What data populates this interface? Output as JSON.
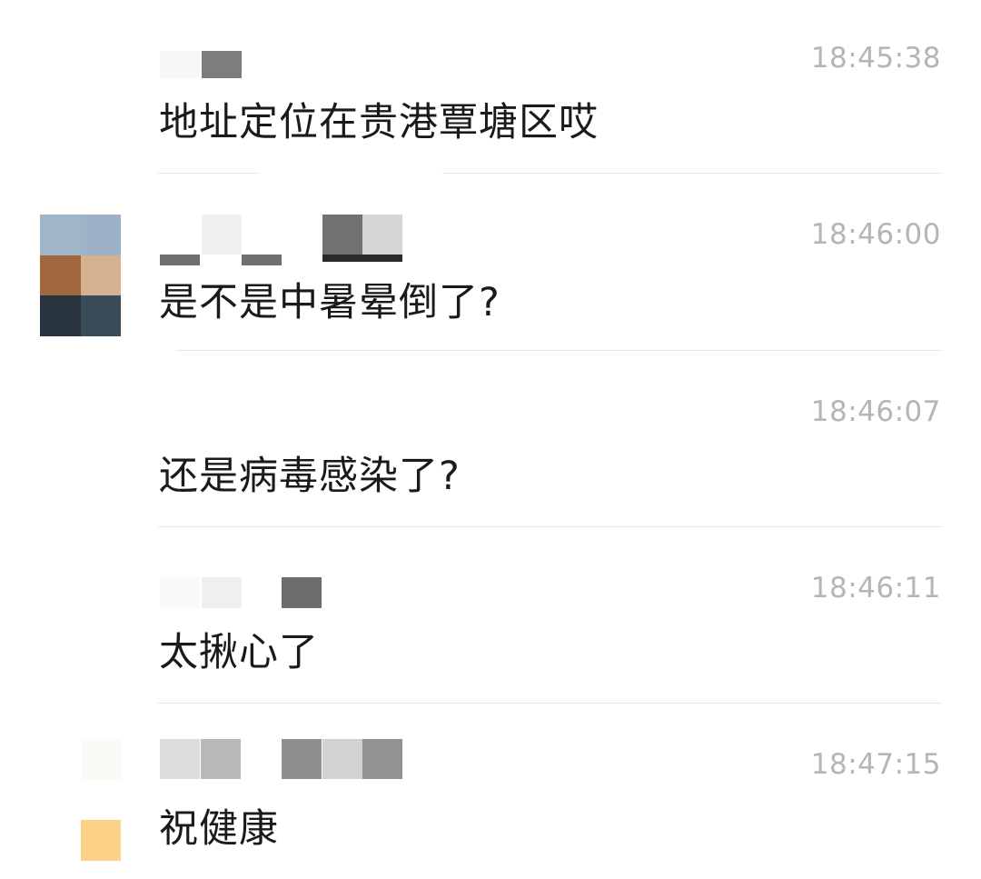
{
  "messages": [
    {
      "time": "18:45:38",
      "text": "地址定位在贵港覃塘区哎",
      "avatar_colors": []
    },
    {
      "time": "18:46:00",
      "text": "是不是中暑晕倒了?",
      "avatar_colors": [
        "#9fb5c8",
        "#9db2c6",
        "#a0673f",
        "#d6b191",
        "#27343f",
        "#3a4c58"
      ]
    },
    {
      "time": "18:46:07",
      "text": "还是病毒感染了?",
      "avatar_colors": []
    },
    {
      "time": "18:46:11",
      "text": "太揪心了",
      "avatar_colors": []
    },
    {
      "time": "18:47:15",
      "text": "祝健康",
      "avatar_colors": [
        "#ffffff",
        "#fbfaf6",
        "#ffffff",
        "#ffffff",
        "#fcd188",
        "#ffffff"
      ]
    }
  ]
}
